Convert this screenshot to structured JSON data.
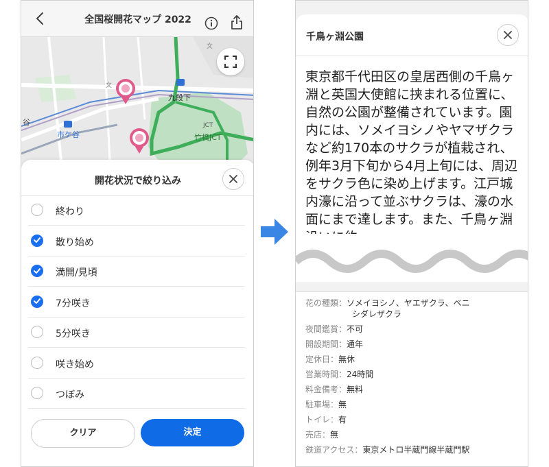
{
  "left": {
    "header": {
      "title": "全国桜開花マップ 2022"
    },
    "map": {
      "labels": [
        "九段下",
        "市ケ谷",
        "竹橋JCT",
        "JCT",
        "文",
        "文",
        "谷"
      ]
    },
    "filter": {
      "title": "開花状況で絞り込み",
      "options": [
        {
          "label": "終わり",
          "checked": false
        },
        {
          "label": "散り始め",
          "checked": true
        },
        {
          "label": "満開/見頃",
          "checked": true
        },
        {
          "label": "7分咲き",
          "checked": true
        },
        {
          "label": "5分咲き",
          "checked": false
        },
        {
          "label": "咲き始め",
          "checked": false
        },
        {
          "label": "つぼみ",
          "checked": false
        }
      ],
      "clear_label": "クリア",
      "apply_label": "決定"
    }
  },
  "right": {
    "title": "千鳥ヶ淵公園",
    "description": "東京都千代田区の皇居西側の千鳥ヶ淵と英国大使館に挟まれる位置に、自然の公園が整備されています。園内には、ソメイヨシノやヤマザクラなど約170本のサクラが植栽され、例年3月下旬から4月上旬には、周辺をサクラ色に染め上げます。江戸城内濠に沿って並ぶサクラは、濠の水面にまで達します。また、千鳥ヶ淵沿いに約",
    "details": [
      {
        "key": "花の種類",
        "sep": "：",
        "value": "ソメイヨシノ、ヤエザクラ、ベニ",
        "value2": "シダレザクラ"
      },
      {
        "key": "夜間鑑賞",
        "sep": "：",
        "value": "不可"
      },
      {
        "key": "開設期間",
        "sep": "：",
        "value": "通年"
      },
      {
        "key": "定休日",
        "sep": "：",
        "value": "無休"
      },
      {
        "key": "営業時間",
        "sep": "：",
        "value": "24時間"
      },
      {
        "key": "料金備考",
        "sep": "：",
        "value": "無料"
      },
      {
        "key": "駐車場",
        "sep": "：",
        "value": "無"
      },
      {
        "key": "トイレ",
        "sep": "：",
        "value": "有"
      },
      {
        "key": "売店",
        "sep": "：",
        "value": "無"
      },
      {
        "key": "鉄道アクセス",
        "sep": "：",
        "value": "東京メトロ半蔵門線半蔵門駅"
      }
    ]
  },
  "colors": {
    "accent": "#0f6ce6",
    "checkbox_on": "#1a6ef0",
    "arrow": "#3a86e4",
    "map_green": "#3fae5a",
    "pin_pink": "#e05a8a"
  }
}
